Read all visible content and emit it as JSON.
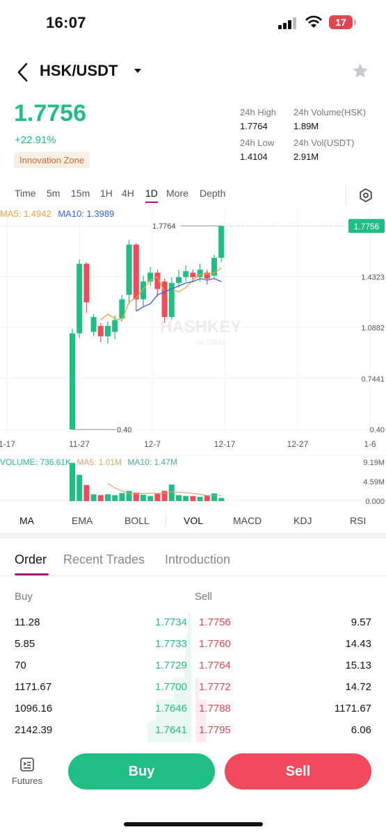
{
  "status_bar": {
    "time": "16:07",
    "battery": "17"
  },
  "header": {
    "pair": "HSK/USDT"
  },
  "ticker": {
    "last_price": "1.7756",
    "change_pct": "+22.91%",
    "zone": "Innovation Zone",
    "high_label": "24h High",
    "high": "1.7764",
    "low_label": "24h Low",
    "low": "1.4104",
    "volume_label": "24h Volume(HSK)",
    "volume": "1.89M",
    "vol_usdt_label": "24h Vol(USDT)",
    "vol_usdt": "2.91M"
  },
  "period_tabs": [
    "Time",
    "5m",
    "15m",
    "1H",
    "4H",
    "1D",
    "More",
    "Depth"
  ],
  "active_period": "1D",
  "chart": {
    "ma5_legend": "MA5: 1.4942",
    "ma10_legend": "MA10: 1.3989",
    "watermark": "HASHKEY",
    "watermark_sub": "GLOBAL",
    "price_tag": "1.7756",
    "high_marker": "1.7764",
    "low_marker": "0.40",
    "y_ticks": [
      "1.4323",
      "1.0882",
      "0.7441",
      "0.40"
    ],
    "x_ticks": [
      "1-17",
      "11-27",
      "12-7",
      "12-17",
      "12-27",
      "1-6"
    ],
    "volume_legend": "VOLUME: 736.61K",
    "vol_ma5_legend": "MA5: 1.01M",
    "vol_ma10_legend": "MA10: 1.47M",
    "vol_ticks": [
      "9.19M",
      "4.59M",
      "0.000"
    ],
    "colors": {
      "up": "#1fbe85",
      "down": "#f04a5c",
      "ma5": "#f0a33a",
      "ma10": "#2e64d8"
    }
  },
  "chart_data": {
    "type": "candlestick",
    "y_range": [
      0.4,
      1.7764
    ],
    "candles": [
      {
        "o": 0.4,
        "c": 1.05,
        "h": 1.08,
        "l": 0.4
      },
      {
        "o": 1.05,
        "c": 1.52,
        "h": 1.55,
        "l": 1.02
      },
      {
        "o": 1.52,
        "c": 1.26,
        "h": 1.53,
        "l": 1.19
      },
      {
        "o": 1.06,
        "c": 1.16,
        "h": 1.18,
        "l": 1.03
      },
      {
        "o": 1.1,
        "c": 1.03,
        "h": 1.12,
        "l": 0.99
      },
      {
        "o": 1.03,
        "c": 1.1,
        "h": 1.13,
        "l": 0.98
      },
      {
        "o": 1.06,
        "c": 1.14,
        "h": 1.17,
        "l": 1.01
      },
      {
        "o": 1.15,
        "c": 1.28,
        "h": 1.31,
        "l": 1.13
      },
      {
        "o": 1.31,
        "c": 1.65,
        "h": 1.68,
        "l": 1.25
      },
      {
        "o": 1.65,
        "c": 1.28,
        "h": 1.66,
        "l": 1.2
      },
      {
        "o": 1.28,
        "c": 1.4,
        "h": 1.44,
        "l": 1.23
      },
      {
        "o": 1.4,
        "c": 1.46,
        "h": 1.5,
        "l": 1.37
      },
      {
        "o": 1.46,
        "c": 1.35,
        "h": 1.48,
        "l": 1.3
      },
      {
        "o": 1.4,
        "c": 1.16,
        "h": 1.42,
        "l": 1.12
      },
      {
        "o": 1.16,
        "c": 1.39,
        "h": 1.43,
        "l": 1.14
      },
      {
        "o": 1.39,
        "c": 1.43,
        "h": 1.48,
        "l": 1.36
      },
      {
        "o": 1.43,
        "c": 1.47,
        "h": 1.51,
        "l": 1.4
      },
      {
        "o": 1.46,
        "c": 1.43,
        "h": 1.48,
        "l": 1.4
      },
      {
        "o": 1.43,
        "c": 1.48,
        "h": 1.52,
        "l": 1.4
      },
      {
        "o": 1.46,
        "c": 1.42,
        "h": 1.48,
        "l": 1.38
      },
      {
        "o": 1.44,
        "c": 1.56,
        "h": 1.58,
        "l": 1.42
      },
      {
        "o": 1.56,
        "c": 1.7756,
        "h": 1.7764,
        "l": 1.53
      }
    ],
    "ma5": [
      null,
      null,
      null,
      null,
      1.14,
      1.18,
      1.15,
      1.14,
      1.26,
      1.29,
      1.35,
      1.41,
      1.43,
      1.33,
      1.35,
      1.33,
      1.36,
      1.41,
      1.45,
      1.45,
      1.46,
      1.49
    ],
    "ma10": [
      null,
      null,
      null,
      null,
      null,
      null,
      null,
      null,
      null,
      1.2,
      1.23,
      1.25,
      1.31,
      1.33,
      1.35,
      1.37,
      1.39,
      1.4,
      1.42,
      1.41,
      1.42,
      1.4
    ],
    "volume": [
      9.0,
      6.2,
      3.8,
      1.6,
      1.4,
      1.6,
      1.4,
      1.9,
      2.4,
      2.0,
      1.5,
      1.2,
      1.8,
      2.4,
      3.9,
      1.4,
      1.2,
      1.2,
      1.0,
      1.4,
      1.8,
      0.74
    ],
    "volume_range": [
      0,
      9.19
    ],
    "vol_ma5": [
      null,
      null,
      null,
      null,
      null,
      4.2,
      3.1,
      2.4,
      1.8,
      1.7,
      1.8,
      1.9,
      1.8,
      1.9,
      2.2,
      2.1,
      2.0,
      1.8,
      1.6,
      1.3,
      1.3,
      1.3
    ]
  },
  "indicator_tabs": [
    "MA",
    "EMA",
    "BOLL",
    "VOL",
    "MACD",
    "KDJ",
    "RSI"
  ],
  "content_tabs": [
    "Order",
    "Recent Trades",
    "Introduction"
  ],
  "order_book": {
    "buy_label": "Buy",
    "sell_label": "Sell",
    "rows": [
      {
        "buy_qty": "11.28",
        "buy_price": "1.7734",
        "sell_price": "1.7756",
        "sell_qty": "9.57"
      },
      {
        "buy_qty": "5.85",
        "buy_price": "1.7733",
        "sell_price": "1.7760",
        "sell_qty": "14.43"
      },
      {
        "buy_qty": "70",
        "buy_price": "1.7729",
        "sell_price": "1.7764",
        "sell_qty": "15.13"
      },
      {
        "buy_qty": "1171.67",
        "buy_price": "1.7700",
        "sell_price": "1.7772",
        "sell_qty": "14.72"
      },
      {
        "buy_qty": "1096.16",
        "buy_price": "1.7646",
        "sell_price": "1.7788",
        "sell_qty": "1171.67"
      },
      {
        "buy_qty": "2142.39",
        "buy_price": "1.7641",
        "sell_price": "1.7795",
        "sell_qty": "6.06"
      }
    ],
    "buy_depth": [
      0.02,
      0.03,
      0.04,
      0.1,
      0.2,
      0.25
    ],
    "sell_depth": [
      0.0,
      0.0,
      0.0,
      0.02,
      0.06,
      0.06
    ]
  },
  "bottom_bar": {
    "futures_label": "Futures",
    "buy_label": "Buy",
    "sell_label": "Sell"
  }
}
